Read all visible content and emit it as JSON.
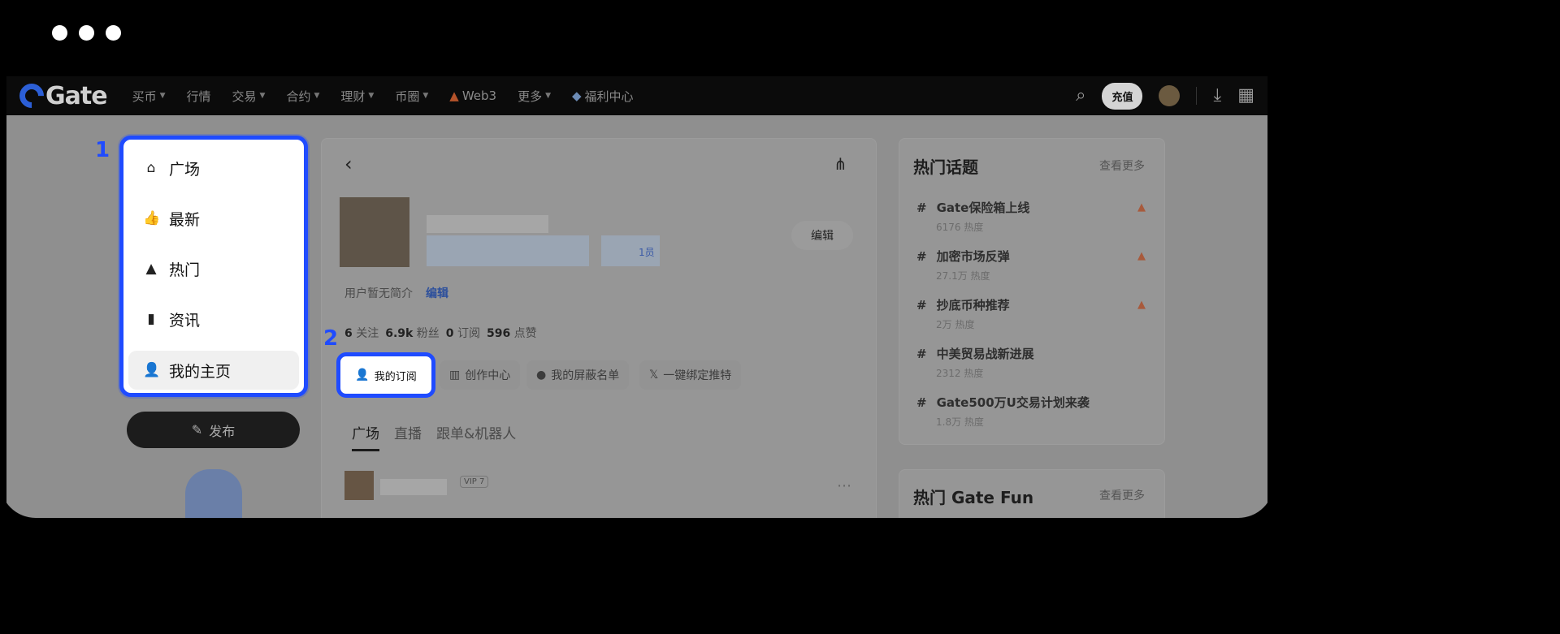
{
  "nav": {
    "logo_text": "Gate",
    "items": [
      {
        "label": "买币",
        "caret": true
      },
      {
        "label": "行情",
        "caret": false
      },
      {
        "label": "交易",
        "caret": true
      },
      {
        "label": "合约",
        "caret": true
      },
      {
        "label": "理财",
        "caret": true
      },
      {
        "label": "币圈",
        "caret": true
      },
      {
        "label": "Web3",
        "caret": false
      },
      {
        "label": "更多",
        "caret": true
      },
      {
        "label": "福利中心",
        "caret": false
      }
    ],
    "deposit_label": "充值"
  },
  "left_menu": {
    "items": [
      {
        "label": "广场",
        "icon": "home-icon"
      },
      {
        "label": "最新",
        "icon": "thumbs-up-icon"
      },
      {
        "label": "热门",
        "icon": "flame-icon"
      },
      {
        "label": "资讯",
        "icon": "book-icon"
      },
      {
        "label": "我的主页",
        "icon": "user-icon"
      }
    ],
    "publish_label": "发布"
  },
  "callouts": {
    "one": "1",
    "two": "2"
  },
  "profile": {
    "bio": "用户暂无简介",
    "bio_edit": "编辑",
    "edit_button": "编辑",
    "member_tag": "1员",
    "stats": {
      "following_count": "6",
      "following_label": "关注",
      "fans_count": "6.9k",
      "fans_label": "粉丝",
      "subs_count": "0",
      "subs_label": "订阅",
      "likes_count": "596",
      "likes_label": "点赞"
    },
    "actions": {
      "subscriptions": "我的订阅",
      "creator_center": "创作中心",
      "block_list": "我的屏蔽名单",
      "bind_twitter": "一键绑定推特"
    },
    "tabs": [
      "广场",
      "直播",
      "跟单&机器人"
    ],
    "post_vip": "VIP 7"
  },
  "hot_topics": {
    "title": "热门话题",
    "more": "查看更多",
    "items": [
      {
        "title": "Gate保险箱上线",
        "heat": "6176 热度",
        "hot": true
      },
      {
        "title": "加密市场反弹",
        "heat": "27.1万 热度",
        "hot": true
      },
      {
        "title": "抄底币种推荐",
        "heat": "2万 热度",
        "hot": true
      },
      {
        "title": "中美贸易战新进展",
        "heat": "2312 热度",
        "hot": false
      },
      {
        "title": "Gate500万U交易计划来袭",
        "heat": "1.8万 热度",
        "hot": false
      }
    ]
  },
  "gate_fun": {
    "title": "热门 Gate Fun",
    "more": "查看更多"
  },
  "colors": {
    "highlight": "#1f4bff",
    "brand": "#2c5fd6"
  }
}
